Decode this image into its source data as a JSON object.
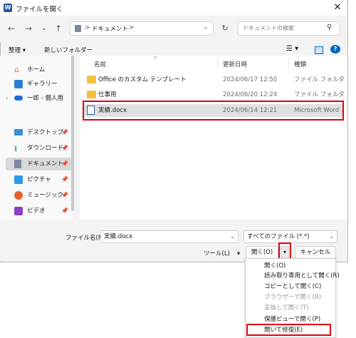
{
  "window": {
    "title": "ファイルを開く",
    "app_icon": "W",
    "close": "✕"
  },
  "nav": {
    "back": "←",
    "forward": "→",
    "down": "⌄",
    "up": "↑",
    "breadcrumb": [
      ">",
      "ドキュメント",
      ">"
    ],
    "refresh": "↻",
    "search_placeholder": "ドキュメントの検索"
  },
  "toolbar": {
    "organize": "整理 ▾",
    "new_folder": "新しいフォルダー"
  },
  "columns": {
    "name": "名前",
    "date": "更新日時",
    "type": "種類"
  },
  "sidebar": [
    {
      "label": "ホーム",
      "icon": "home-icon",
      "pin": ""
    },
    {
      "label": "ギャラリー",
      "icon": "gallery-icon",
      "pin": ""
    },
    {
      "label": "一郎 - 個人用",
      "icon": "onedrive-icon",
      "pin": ""
    },
    {
      "label": "デスクトップ",
      "icon": "desktop-icon",
      "pin": "📌"
    },
    {
      "label": "ダウンロード",
      "icon": "download-icon",
      "pin": "📌"
    },
    {
      "label": "ドキュメント",
      "icon": "documents-icon",
      "pin": "📌"
    },
    {
      "label": "ピクチャ",
      "icon": "pictures-icon",
      "pin": "📌"
    },
    {
      "label": "ミュージック",
      "icon": "music-icon",
      "pin": "📌"
    },
    {
      "label": "ビデオ",
      "icon": "video-icon",
      "pin": "📌"
    }
  ],
  "files": [
    {
      "name": "Office のカスタム テンプレート",
      "date": "2024/06/17 12:50",
      "type": "ファイル フォルダー"
    },
    {
      "name": "仕事用",
      "date": "2024/06/20 12:24",
      "type": "ファイル フォルダー"
    },
    {
      "name": "実績.docx",
      "date": "2024/06/14 12:21",
      "type": "Microsoft Word ..."
    }
  ],
  "bottom": {
    "filename_label": "ファイル名(N):",
    "filename_value": "実績.docx",
    "filter": "すべてのファイル (*.*)",
    "tools": "ツール(L)",
    "open": "開く(O)",
    "cancel": "キャンセル",
    "open_dropdown": "▾"
  },
  "menu": [
    {
      "label": "開く(O)",
      "enabled": true
    },
    {
      "label": "読み取り専用として開く(R)",
      "enabled": true
    },
    {
      "label": "コピーとして開く(C)",
      "enabled": true
    },
    {
      "label": "ブラウザーで開く(B)",
      "enabled": false
    },
    {
      "label": "変換して開く(T)",
      "enabled": false
    },
    {
      "label": "保護ビューで開く(P)",
      "enabled": true
    },
    {
      "label": "開いて修復(E)",
      "enabled": true
    }
  ],
  "colors": {
    "highlight": "#e00012",
    "accent": "#0067c0",
    "folder": "#f4c13f"
  }
}
